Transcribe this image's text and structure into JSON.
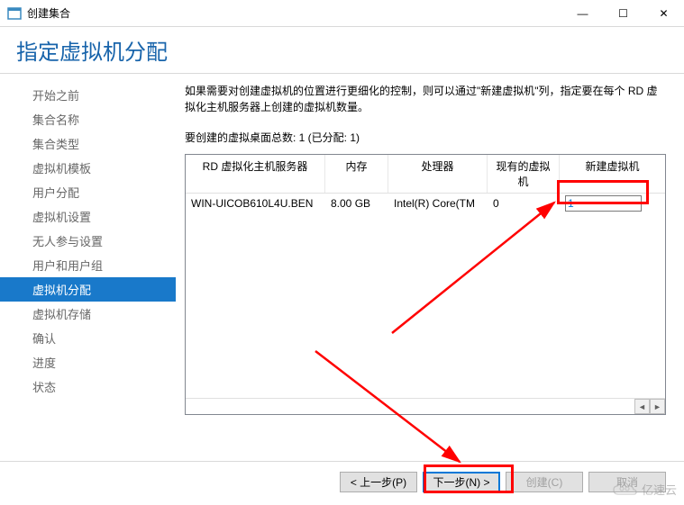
{
  "window": {
    "title": "创建集合",
    "minimize": "—",
    "maximize": "☐",
    "close": "✕"
  },
  "page": {
    "title": "指定虚拟机分配"
  },
  "sidebar": {
    "items": [
      {
        "label": "开始之前"
      },
      {
        "label": "集合名称"
      },
      {
        "label": "集合类型"
      },
      {
        "label": "虚拟机模板"
      },
      {
        "label": "用户分配"
      },
      {
        "label": "虚拟机设置"
      },
      {
        "label": "无人参与设置"
      },
      {
        "label": "用户和用户组"
      },
      {
        "label": "虚拟机分配"
      },
      {
        "label": "虚拟机存储"
      },
      {
        "label": "确认"
      },
      {
        "label": "进度"
      },
      {
        "label": "状态"
      }
    ],
    "selected_index": 8
  },
  "main": {
    "description": "如果需要对创建虚拟机的位置进行更细化的控制，则可以通过\"新建虚拟机\"列，指定要在每个 RD 虚拟化主机服务器上创建的虚拟机数量。",
    "summary": "要创建的虚拟桌面总数: 1 (已分配: 1)",
    "columns": {
      "c1": "RD 虚拟化主机服务器",
      "c2": "内存",
      "c3": "处理器",
      "c4": "现有的虚拟机",
      "c5": "新建虚拟机"
    },
    "rows": [
      {
        "host": "WIN-UICOB610L4U.BEN",
        "memory": "8.00 GB",
        "cpu": "Intel(R) Core(TM",
        "existing": "0",
        "newvm": "1"
      }
    ],
    "scroll_left": "◄",
    "scroll_right": "►"
  },
  "footer": {
    "prev": "< 上一步(P)",
    "next": "下一步(N) >",
    "create": "创建(C)",
    "cancel": "取消"
  },
  "watermark": {
    "text": "亿速云"
  },
  "colors": {
    "accent": "#0078d7",
    "highlight": "#ff0000",
    "title": "#1864ab"
  }
}
